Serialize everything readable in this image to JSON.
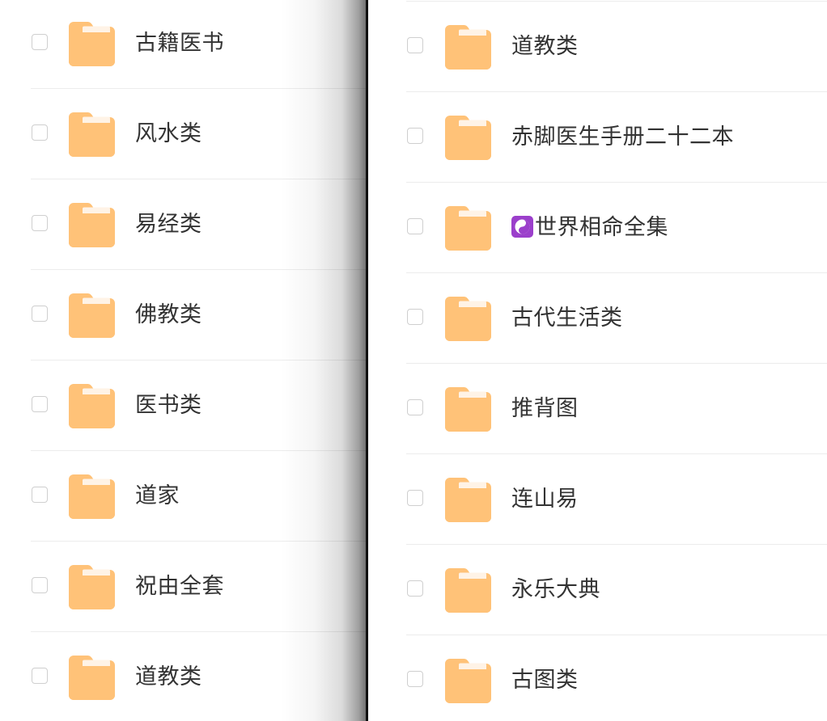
{
  "left_pane": {
    "items": [
      {
        "label": "古籍医书",
        "checked": false,
        "icon": "folder-icon"
      },
      {
        "label": "风水类",
        "checked": false,
        "icon": "folder-icon"
      },
      {
        "label": "易经类",
        "checked": false,
        "icon": "folder-icon"
      },
      {
        "label": "佛教类",
        "checked": false,
        "icon": "folder-icon"
      },
      {
        "label": "医书类",
        "checked": false,
        "icon": "folder-icon"
      },
      {
        "label": "道家",
        "checked": false,
        "icon": "folder-icon"
      },
      {
        "label": "祝由全套",
        "checked": false,
        "icon": "folder-icon"
      },
      {
        "label": "道教类",
        "checked": false,
        "icon": "folder-icon"
      }
    ]
  },
  "right_pane": {
    "items": [
      {
        "label": "道教类",
        "checked": false,
        "icon": "folder-icon"
      },
      {
        "label": "赤脚医生手册二十二本",
        "checked": false,
        "icon": "folder-icon"
      },
      {
        "label": "世界相命全集",
        "checked": false,
        "icon": "folder-icon",
        "prefix_icon": "yin-yang-icon"
      },
      {
        "label": "古代生活类",
        "checked": false,
        "icon": "folder-icon"
      },
      {
        "label": "推背图",
        "checked": false,
        "icon": "folder-icon"
      },
      {
        "label": "连山易",
        "checked": false,
        "icon": "folder-icon"
      },
      {
        "label": "永乐大典",
        "checked": false,
        "icon": "folder-icon"
      },
      {
        "label": "古图类",
        "checked": false,
        "icon": "folder-icon"
      }
    ]
  },
  "colors": {
    "folder": "#FFC278",
    "folder_light": "#FFF3E6",
    "text": "#333333",
    "divider": "#ECECEC",
    "checkbox_border": "#CFCFCF",
    "yin_yang_badge": "#9B3FCB"
  }
}
